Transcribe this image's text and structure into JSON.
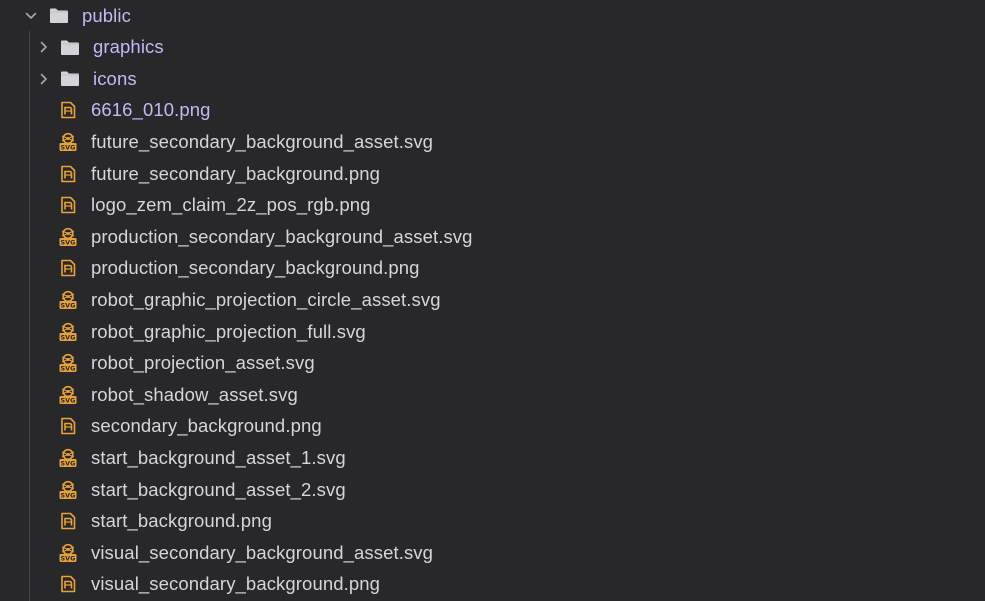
{
  "explorer": {
    "root": {
      "label": "public",
      "expanded": true,
      "icon": "folder-icon"
    },
    "items": [
      {
        "label": "graphics",
        "type": "folder",
        "expanded": false,
        "icon": "folder-icon"
      },
      {
        "label": "icons",
        "type": "folder",
        "expanded": false,
        "icon": "folder-icon"
      },
      {
        "label": "6616_010.png",
        "type": "png",
        "icon": "image-file-icon"
      },
      {
        "label": "future_secondary_background_asset.svg",
        "type": "svg",
        "icon": "svg-file-icon"
      },
      {
        "label": "future_secondary_background.png",
        "type": "png",
        "icon": "image-file-icon"
      },
      {
        "label": "logo_zem_claim_2z_pos_rgb.png",
        "type": "png",
        "icon": "image-file-icon"
      },
      {
        "label": "production_secondary_background_asset.svg",
        "type": "svg",
        "icon": "svg-file-icon"
      },
      {
        "label": "production_secondary_background.png",
        "type": "png",
        "icon": "image-file-icon"
      },
      {
        "label": "robot_graphic_projection_circle_asset.svg",
        "type": "svg",
        "icon": "svg-file-icon"
      },
      {
        "label": "robot_graphic_projection_full.svg",
        "type": "svg",
        "icon": "svg-file-icon"
      },
      {
        "label": "robot_projection_asset.svg",
        "type": "svg",
        "icon": "svg-file-icon"
      },
      {
        "label": "robot_shadow_asset.svg",
        "type": "svg",
        "icon": "svg-file-icon"
      },
      {
        "label": "secondary_background.png",
        "type": "png",
        "icon": "image-file-icon"
      },
      {
        "label": "start_background_asset_1.svg",
        "type": "svg",
        "icon": "svg-file-icon"
      },
      {
        "label": "start_background_asset_2.svg",
        "type": "svg",
        "icon": "svg-file-icon"
      },
      {
        "label": "start_background.png",
        "type": "png",
        "icon": "image-file-icon"
      },
      {
        "label": "visual_secondary_background_asset.svg",
        "type": "svg",
        "icon": "svg-file-icon"
      },
      {
        "label": "visual_secondary_background.png",
        "type": "png",
        "icon": "image-file-icon"
      }
    ]
  },
  "colors": {
    "background": "#28282b",
    "text": "#d6d6d8",
    "folder_text": "#c4b8f5",
    "folder_icon": "#d4d4d6",
    "file_icon": "#e8a23a",
    "chevron": "#a8a8ac",
    "guide": "#47474b"
  }
}
